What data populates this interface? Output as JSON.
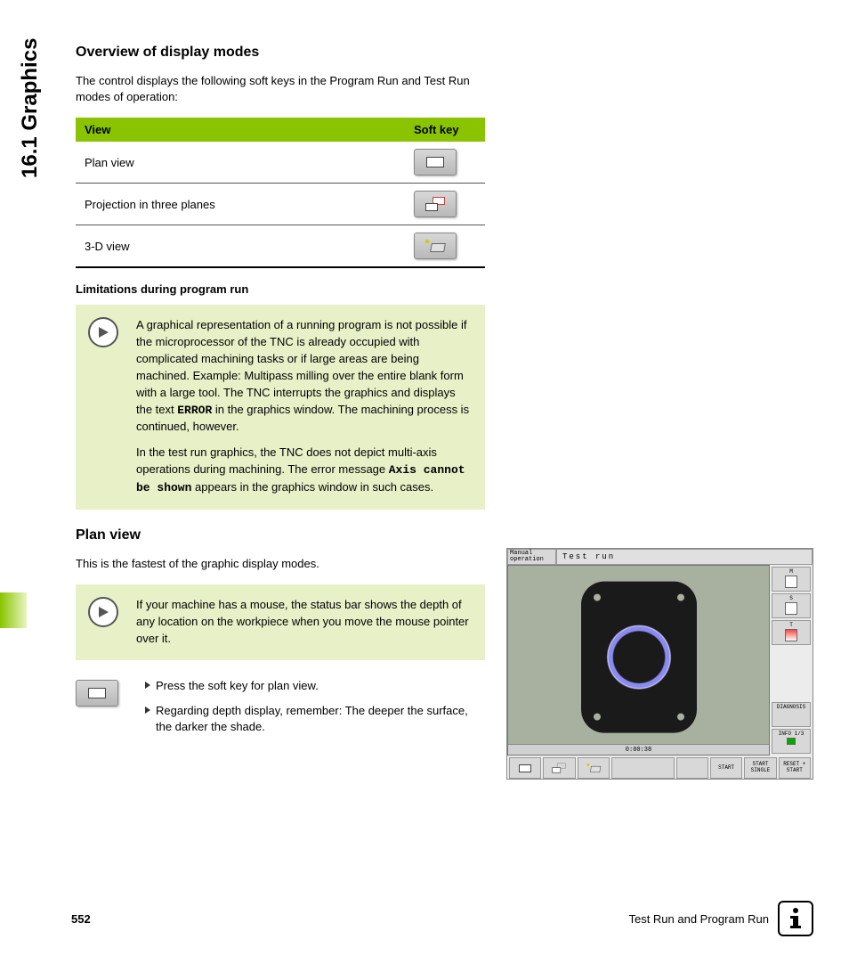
{
  "side_title": "16.1 Graphics",
  "section1": {
    "heading": "Overview of display modes",
    "intro": "The control displays the following soft keys in the Program Run and Test Run modes of operation:",
    "th_view": "View",
    "th_softkey": "Soft key",
    "rows": [
      {
        "label": "Plan view"
      },
      {
        "label": "Projection in three planes"
      },
      {
        "label": "3-D view"
      }
    ],
    "subhead": "Limitations during program run",
    "note_p1a": "A graphical representation of a running program is not possible if the microprocessor of the TNC is already occupied with complicated machining tasks or if large areas are being machined. Example: Multipass milling over the entire blank form with a large tool. The TNC interrupts the graphics and displays the text ",
    "note_p1b": "ERROR",
    "note_p1c": " in the graphics window. The machining process is continued, however.",
    "note_p2a": "In the test run graphics, the TNC does not depict multi-axis operations during machining. The error message ",
    "note_p2b": "Axis cannot be shown",
    "note_p2c": " appears in the graphics window in such cases."
  },
  "section2": {
    "heading": "Plan view",
    "intro": "This is the fastest of the graphic display modes.",
    "note": "If your machine has a mouse, the status bar shows the depth of any location on the workpiece when you move the mouse pointer over it.",
    "step1": "Press the soft key for plan view.",
    "step2": "Regarding depth display, remember: The deeper the surface, the darker the shade."
  },
  "screenshot": {
    "mode": "Manual operation",
    "title": "Test run",
    "time": "0:00:38",
    "side": {
      "m": "M",
      "s": "S",
      "t": "T",
      "diag": "DIAGNOSIS",
      "info": "INFO 1/3"
    },
    "bottom": {
      "start": "START",
      "start_single": "START SINGLE",
      "reset": "RESET + START"
    }
  },
  "footer": {
    "page": "552",
    "chapter": "Test Run and Program Run"
  }
}
